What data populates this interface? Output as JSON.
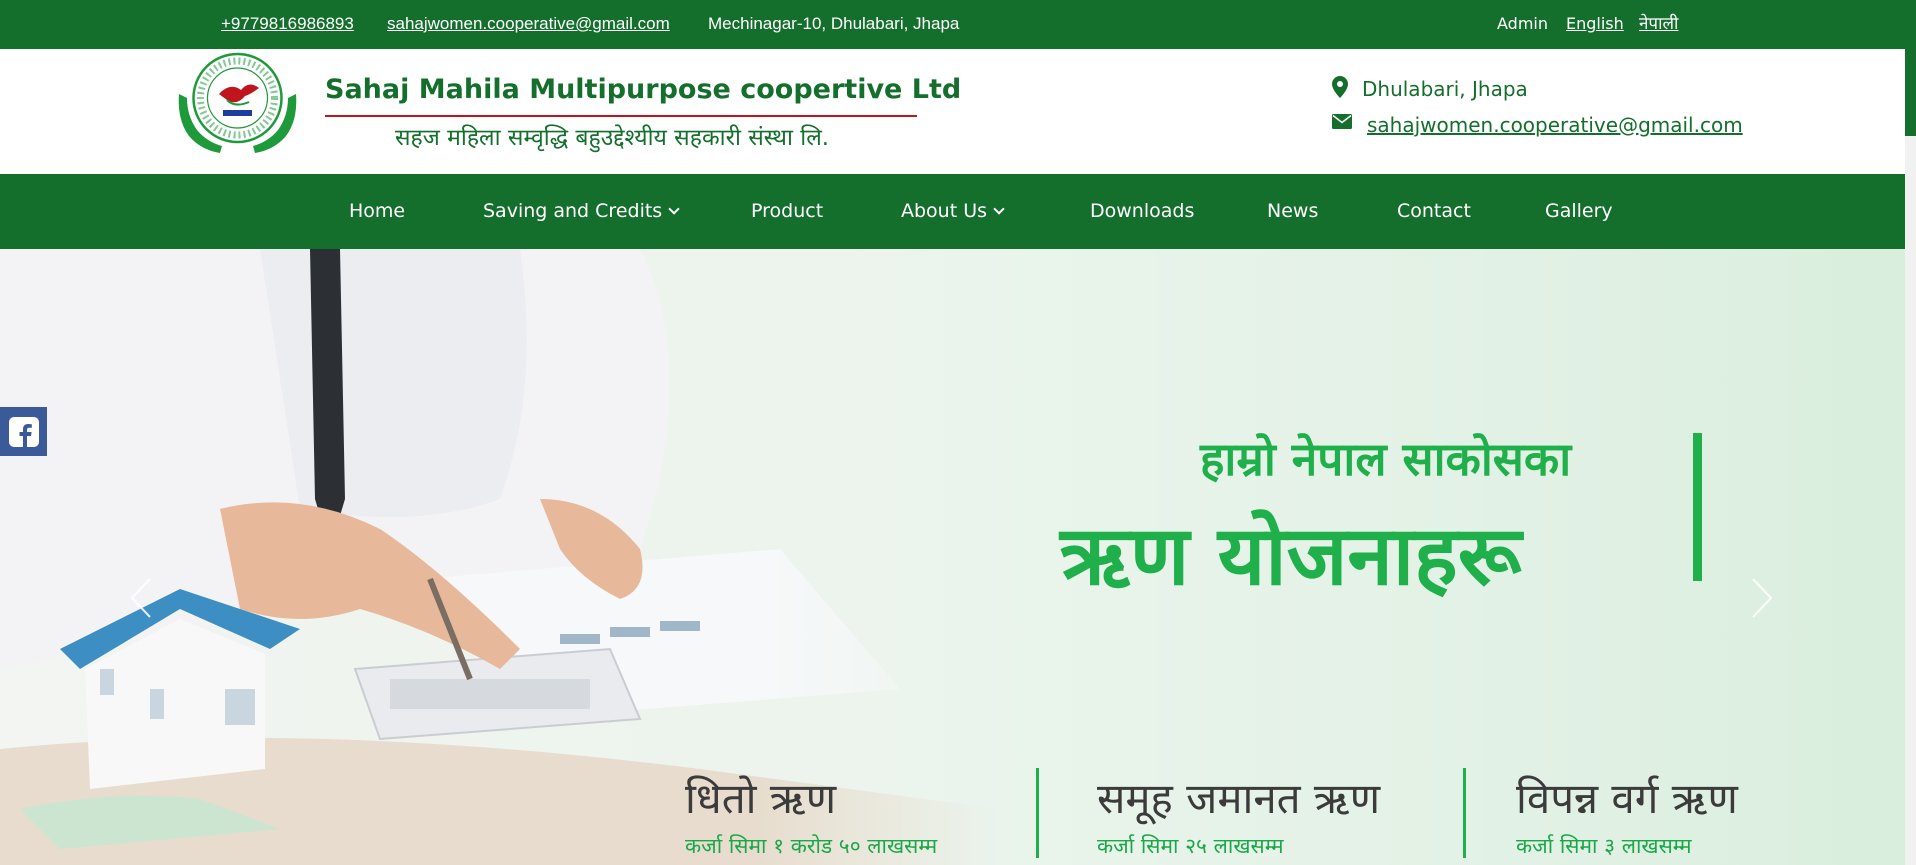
{
  "topbar": {
    "phone": "+9779816986893",
    "email": "sahajwomen.cooperative@gmail.com",
    "address": "Mechinagar-10, Dhulabari, Jhapa",
    "admin": "Admin",
    "english": "English",
    "nepali": "नेपाली",
    "bg_color": "#146e2c"
  },
  "header": {
    "org_name": "Sahaj Mahila Multipurpose coopertive Ltd",
    "org_name_np": "सहज महिला सम्वृद्धि बहुउद्देश्यीय सहकारी संस्था लि.",
    "location": "Dhulabari, Jhapa",
    "email": "sahajwomen.cooperative@gmail.com",
    "location_icon": "map-marker-icon",
    "email_icon": "envelope-icon"
  },
  "nav": {
    "items": [
      {
        "label": "Home",
        "dropdown": false
      },
      {
        "label": "Saving and Credits",
        "dropdown": true
      },
      {
        "label": "Product",
        "dropdown": false
      },
      {
        "label": "About Us",
        "dropdown": true
      },
      {
        "label": "Downloads",
        "dropdown": false
      },
      {
        "label": "News",
        "dropdown": false
      },
      {
        "label": "Contact",
        "dropdown": false
      },
      {
        "label": "Gallery",
        "dropdown": false
      }
    ]
  },
  "hero": {
    "title_line1": "हाम्रो नेपाल साकोसका",
    "title_line2": "ऋण योजनाहरू",
    "loans": [
      {
        "title": "धितो ऋण",
        "subtitle": "कर्जा सिमा १ करोड ५० लाखसम्म"
      },
      {
        "title": "समूह जमानत ऋण",
        "subtitle": "कर्जा सिमा २५ लाखसम्म"
      },
      {
        "title": "विपन्न वर्ग ऋण",
        "subtitle": "कर्जा सिमा ३ लाखसम्म"
      }
    ],
    "accent_color": "#20b04b"
  },
  "social": {
    "facebook_icon": "facebook-icon"
  }
}
